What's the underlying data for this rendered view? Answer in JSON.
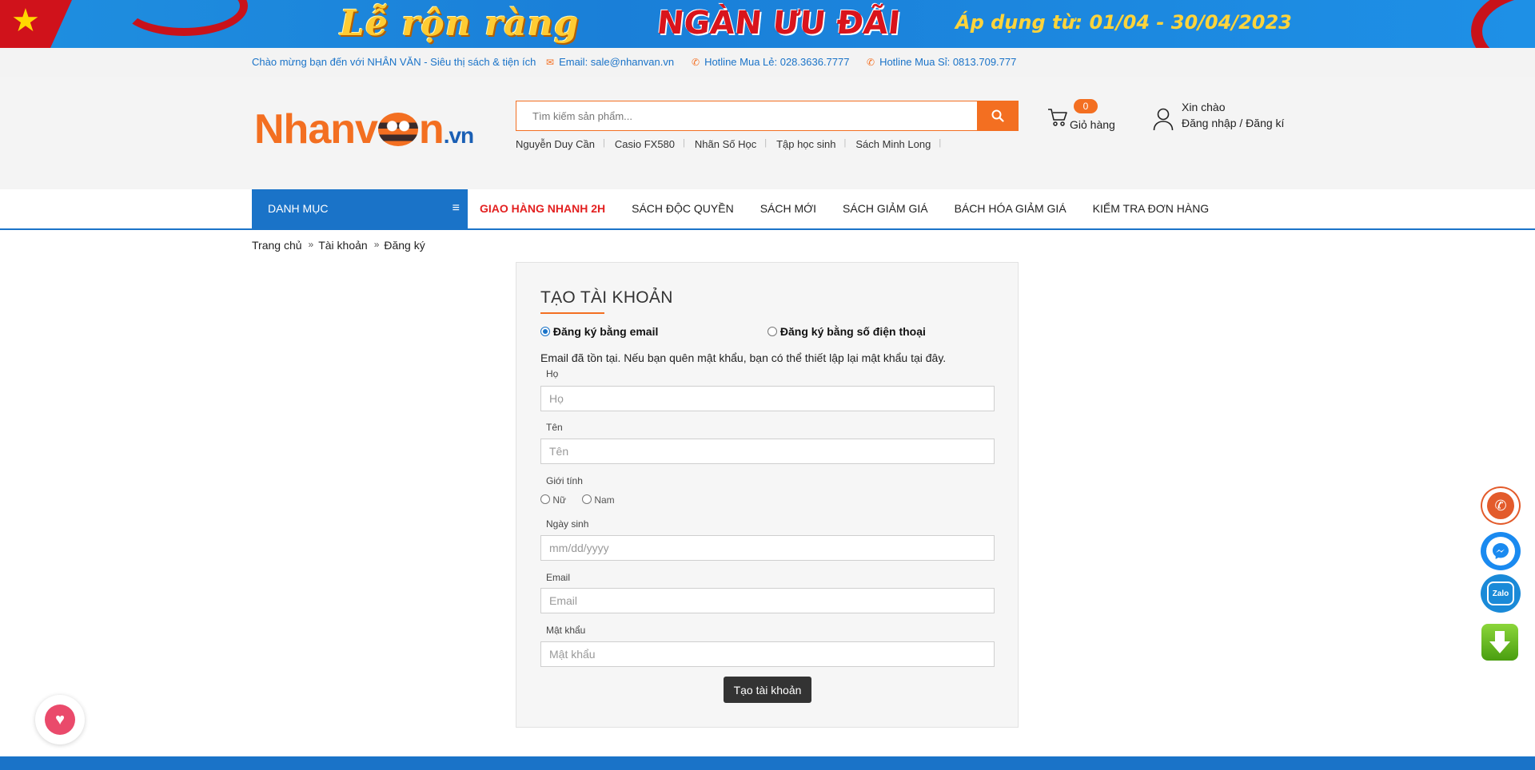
{
  "banner": {
    "text1": "Lễ rộn ràng",
    "text2": "NGÀN ƯU ĐÃI",
    "text3": "Áp dụng từ: 01/04 - 30/04/2023"
  },
  "topbar": {
    "welcome": "Chào mừng bạn đến với NHÂN VĂN - Siêu thị sách & tiện ích",
    "email": "Email: sale@nhanvan.vn",
    "hotline_retail": "Hotline Mua Lẻ: 028.3636.7777",
    "hotline_wholesale": "Hotline Mua Sỉ: 0813.709.777"
  },
  "logo": {
    "part1": "Nhanv",
    "part2": "n",
    "suffix": ".vn"
  },
  "search": {
    "placeholder": "Tìm kiếm sản phẩm..."
  },
  "quick_links": [
    "Nguyễn Duy Cần",
    "Casio FX580",
    "Nhãn Số Học",
    "Tập học sinh",
    "Sách Minh Long"
  ],
  "cart": {
    "count": "0",
    "label": "Giỏ hàng"
  },
  "account": {
    "greeting": "Xin chào",
    "login": "Đăng nhập / Đăng kí"
  },
  "nav": {
    "category": "DANH MỤC",
    "items": [
      "GIAO HÀNG NHANH 2H",
      "SÁCH ĐỘC QUYỀN",
      "SÁCH MỚI",
      "SÁCH GIẢM GIÁ",
      "BÁCH HÓA GIẢM GIÁ",
      "KIỂM TRA ĐƠN HÀNG"
    ]
  },
  "breadcrumb": [
    "Trang chủ",
    "Tài khoản",
    "Đăng ký"
  ],
  "form": {
    "title": "TẠO TÀI KHOẢN",
    "option_email": "Đăng ký bằng email",
    "option_phone": "Đăng ký bằng số điện thoại",
    "selected_option": "email",
    "notice": "Email đã tồn tại. Nếu bạn quên mật khẩu, bạn có thể thiết lập lại mật khẩu tại đây.",
    "last_name_label": "Họ",
    "last_name_placeholder": "Họ",
    "first_name_label": "Tên",
    "first_name_placeholder": "Tên",
    "gender_label": "Giới tính",
    "gender_female": "Nữ",
    "gender_male": "Nam",
    "birthday_label": "Ngày sinh",
    "birthday_placeholder": "mm/dd/yyyy",
    "email_label": "Email",
    "email_placeholder": "Email",
    "password_label": "Mật khẩu",
    "password_placeholder": "Mật khẩu",
    "submit": "Tạo tài khoản"
  },
  "colors": {
    "brand_orange": "#f36f21",
    "brand_blue": "#1a73c8",
    "highlight_red": "#e32020"
  },
  "floating": {
    "zalo": "Zalo"
  }
}
